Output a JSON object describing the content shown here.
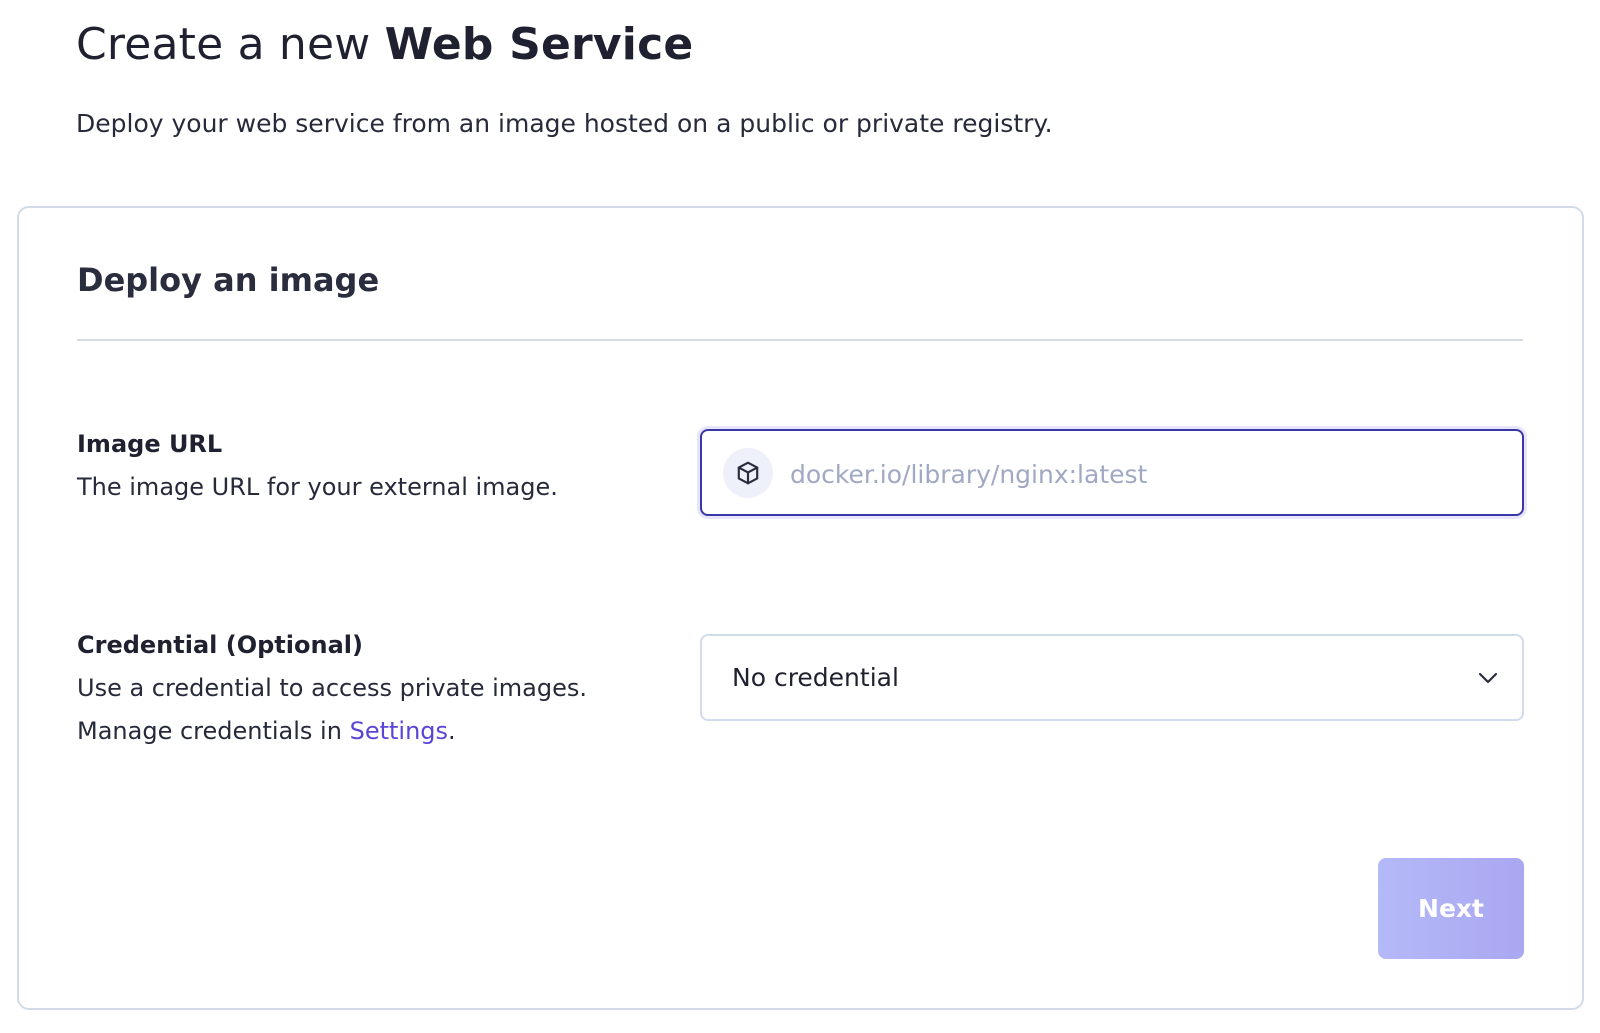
{
  "header": {
    "title_prefix": "Create a new ",
    "title_strong": "Web Service",
    "subtitle": "Deploy your web service from an image hosted on a public or private registry."
  },
  "card": {
    "title": "Deploy an image"
  },
  "image_url": {
    "label": "Image URL",
    "help": "The image URL for your external image.",
    "icon": "cube-icon",
    "value": "",
    "placeholder": "docker.io/library/nginx:latest"
  },
  "credential": {
    "label": "Credential (Optional)",
    "help_line1": "Use a credential to access private images.",
    "help_line2_prefix": "Manage credentials in ",
    "settings_link": "Settings",
    "help_line2_suffix": ".",
    "selected": "No credential",
    "icon": "chevron-down-icon"
  },
  "actions": {
    "next_label": "Next",
    "next_disabled": true
  },
  "colors": {
    "accent": "#3b36a8",
    "link": "#5a46d6",
    "button_disabled": "#b0b3f5",
    "border": "#d3dbeb"
  }
}
